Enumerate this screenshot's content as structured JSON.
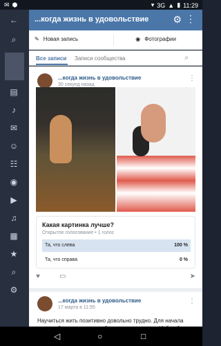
{
  "statusbar": {
    "left_icons": [
      "notification-icon",
      "android-icon"
    ],
    "network": "3G",
    "time": "11:29"
  },
  "rail": {
    "icons": [
      {
        "name": "back-icon",
        "glyph": "←"
      },
      {
        "name": "search-icon",
        "glyph": "⌕"
      },
      {
        "name": "news-icon",
        "glyph": "▤"
      },
      {
        "name": "notifications-icon",
        "glyph": "♪"
      },
      {
        "name": "messages-icon",
        "glyph": "✉"
      },
      {
        "name": "friends-icon",
        "glyph": "☺"
      },
      {
        "name": "groups-icon",
        "glyph": "☷"
      },
      {
        "name": "photos-icon",
        "glyph": "◉"
      },
      {
        "name": "videos-icon",
        "glyph": "▶"
      },
      {
        "name": "music-icon",
        "glyph": "♫"
      },
      {
        "name": "games-icon",
        "glyph": "▦"
      },
      {
        "name": "favorites-icon",
        "glyph": "★"
      },
      {
        "name": "search-rail-icon",
        "glyph": "⌕"
      },
      {
        "name": "settings-icon",
        "glyph": "⚙"
      }
    ]
  },
  "appbar": {
    "title": "...когда жизнь в удовольствие"
  },
  "quick": {
    "new_post": "Новая запись",
    "photos": "Фотографии"
  },
  "tabs": {
    "all_posts": "Все записи",
    "community_posts": "Записи сообщества"
  },
  "post1": {
    "author": "...когда жизнь в удовольствие",
    "time": "30 секунд назад"
  },
  "poll": {
    "question": "Какая картинка лучше?",
    "meta": "Открытое голосование • 1 голос",
    "options": [
      {
        "text": "Та, что слева",
        "percent": "100 %",
        "fill": 1.0
      },
      {
        "text": "Та, что справа",
        "percent": "0 %",
        "fill": 0.0
      }
    ]
  },
  "post2": {
    "author": "...когда жизнь в удовольствие",
    "time": "17 марта в 11:55",
    "text": "Научиться жить позитивно довольно трудно. Для начала постарайтесь окружить себя чем-то приятным. Избегайте"
  },
  "navbar": {
    "back": "◁",
    "home": "○",
    "recent": "□"
  }
}
